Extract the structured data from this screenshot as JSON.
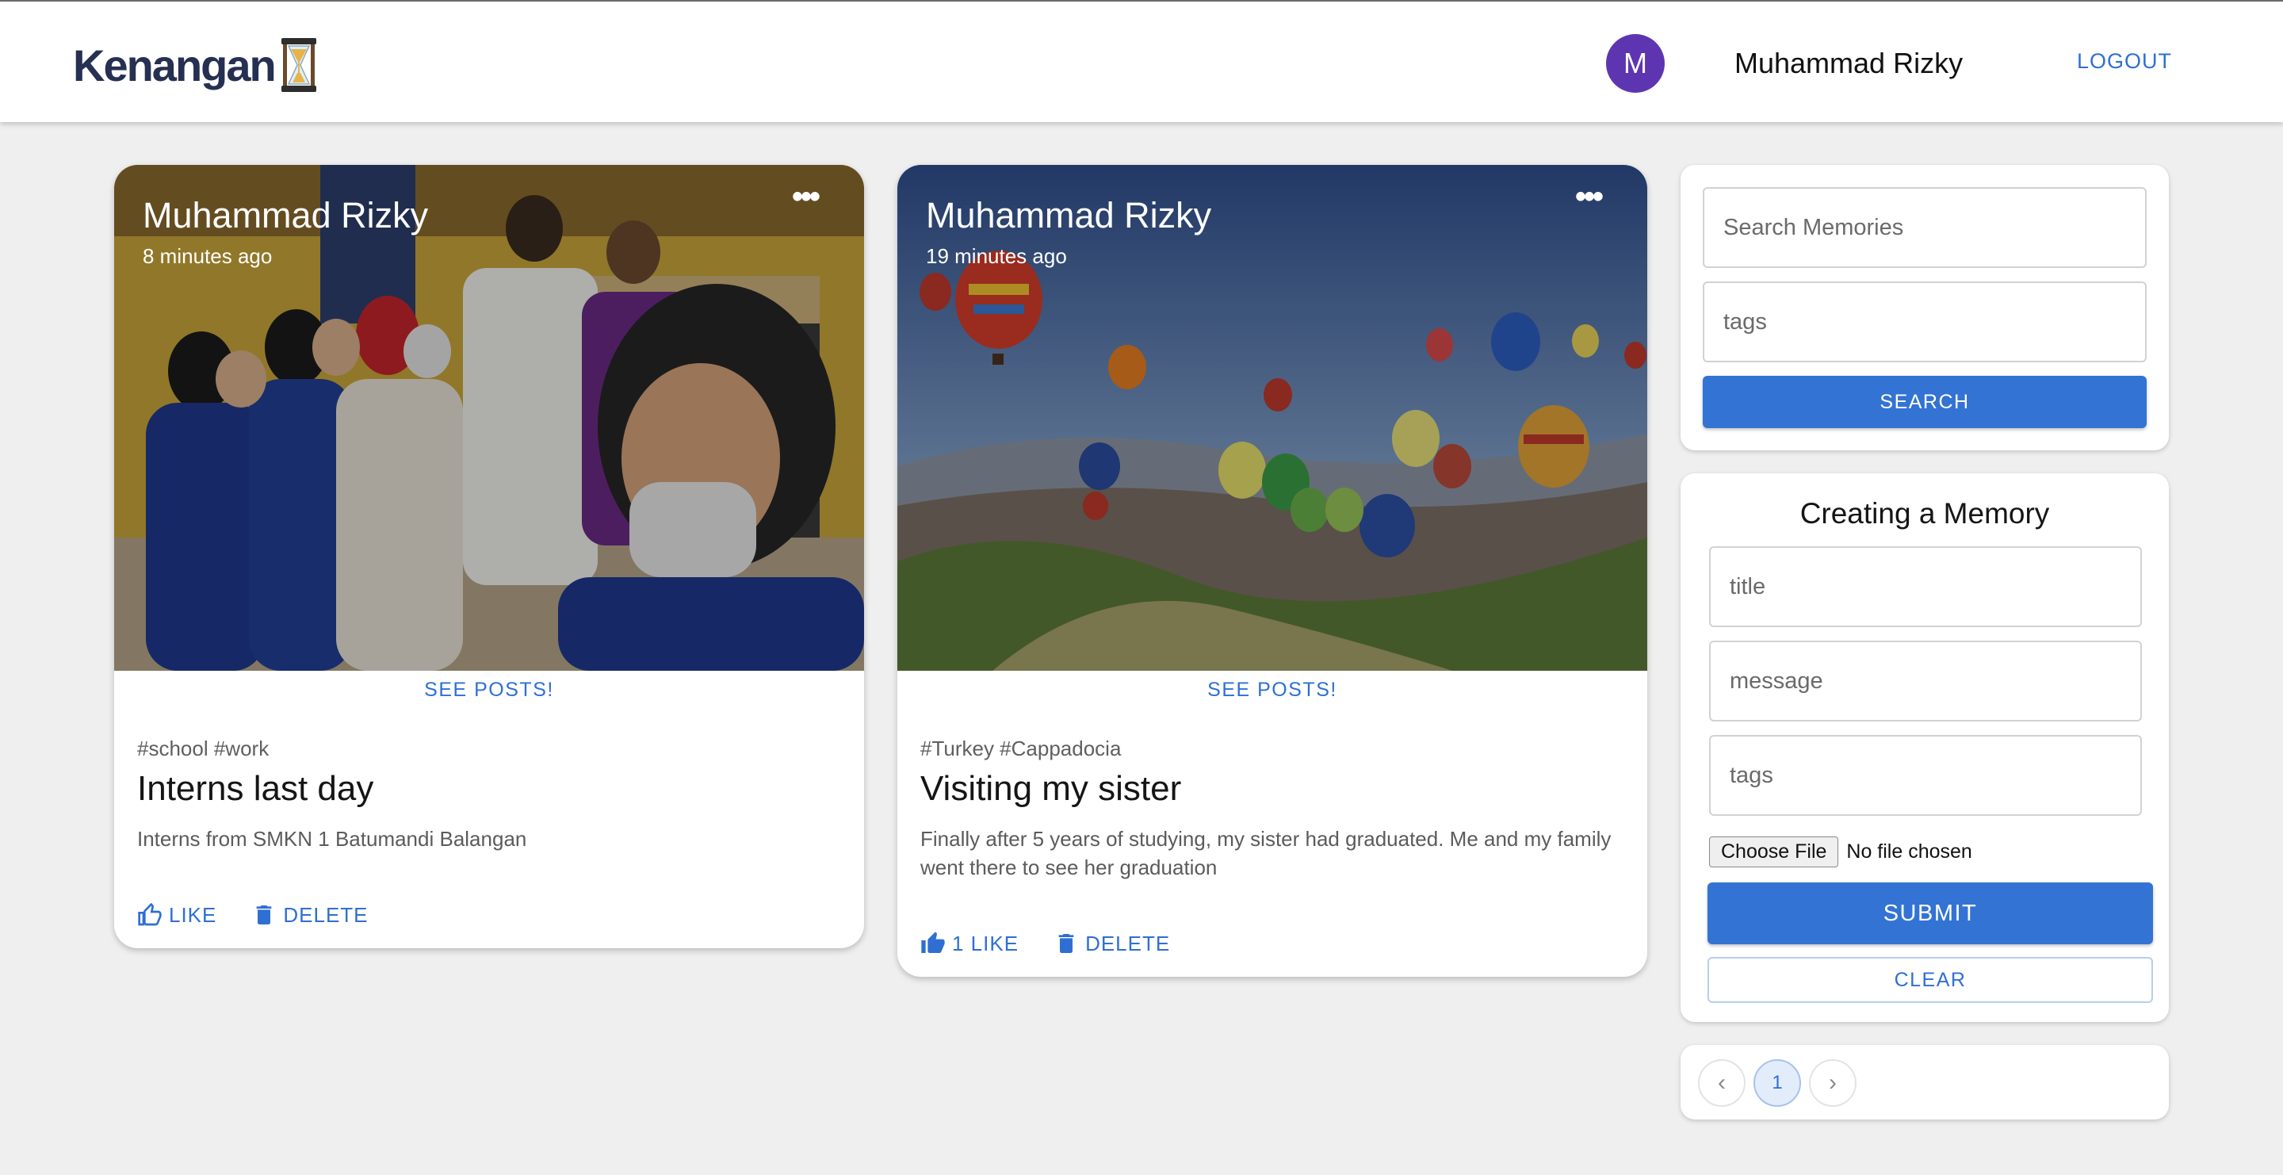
{
  "app": {
    "brand": "Kenangan",
    "user_initial": "M",
    "user_name": "Muhammad Rizky",
    "logout_label": "LOGOUT"
  },
  "posts": [
    {
      "author": "Muhammad Rizky",
      "time": "8 minutes ago",
      "see_posts_label": "SEE POSTS!",
      "tags": "#school #work",
      "title": "Interns last day",
      "message": "Interns from SMKN 1 Batumandi Balangan",
      "like_label": "LIKE",
      "delete_label": "DELETE",
      "image": "group-selfie-photo"
    },
    {
      "author": "Muhammad Rizky",
      "time": "19 minutes ago",
      "see_posts_label": "SEE POSTS!",
      "tags": "#Turkey #Cappadocia",
      "title": "Visiting my sister",
      "message": "Finally after 5 years of studying, my sister had graduated. Me and my family went there to see her graduation",
      "like_label": "1 LIKE",
      "delete_label": "DELETE",
      "image": "hot-air-balloons-photo"
    }
  ],
  "search": {
    "search_placeholder": "Search Memories",
    "tags_placeholder": "tags",
    "button_label": "SEARCH"
  },
  "form": {
    "title": "Creating a Memory",
    "title_placeholder": "title",
    "message_placeholder": "message",
    "tags_placeholder": "tags",
    "file_button": "Choose File",
    "file_status": "No file chosen",
    "submit_label": "SUBMIT",
    "clear_label": "CLEAR"
  },
  "pagination": {
    "prev_icon": "‹",
    "current_page": "1",
    "next_icon": "›"
  },
  "colors": {
    "primary": "#3373d4",
    "avatar": "#5e35b1",
    "brand_text": "#253052",
    "background": "#efefef"
  }
}
